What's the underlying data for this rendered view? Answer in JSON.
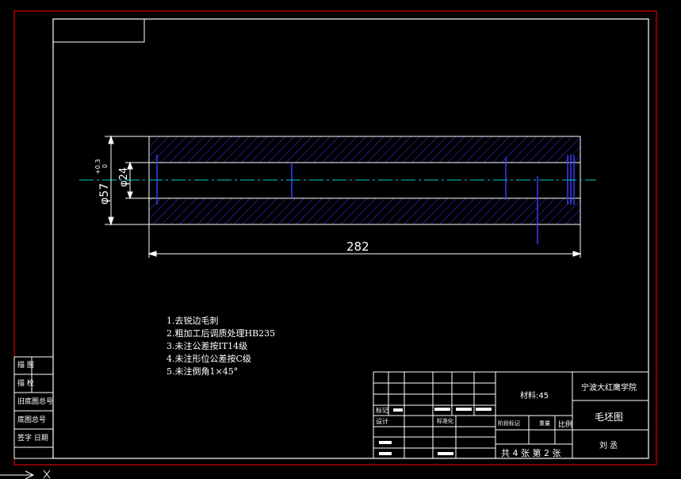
{
  "drawing": {
    "dimensions": {
      "outer_diameter": "φ57",
      "outer_tolerance_upper": "+0.3",
      "outer_tolerance_lower": "0",
      "inner_diameter": "φ24",
      "length": "282"
    },
    "technical_notes": [
      "1.去锐边毛刺",
      "2.粗加工后调质处理HB235",
      "3.未注公差按IT14级",
      "4.未注形位公差按C级",
      "5.未注倒角1×45°"
    ]
  },
  "title_block": {
    "material": "材料:45",
    "school": "宁波大红鹰学院",
    "drawing_name": "毛坯图",
    "drawer": "刘 丞",
    "design_label": "设计",
    "mark_label": "标记",
    "standardize_label": "标准化",
    "stage_label": "阶段标记",
    "weight_label": "重量",
    "scale_label": "比例",
    "sheet_info": "共 4 张 第 2 张"
  },
  "side_table": {
    "rows": [
      "描 图",
      "描 校",
      "旧底图总号",
      "底图总号",
      "签字  日期"
    ]
  },
  "colors": {
    "frame_red": "#ff0000",
    "line_white": "#ffffff",
    "hatch_blue": "#3a3aff",
    "center_cyan": "#00cccc"
  }
}
